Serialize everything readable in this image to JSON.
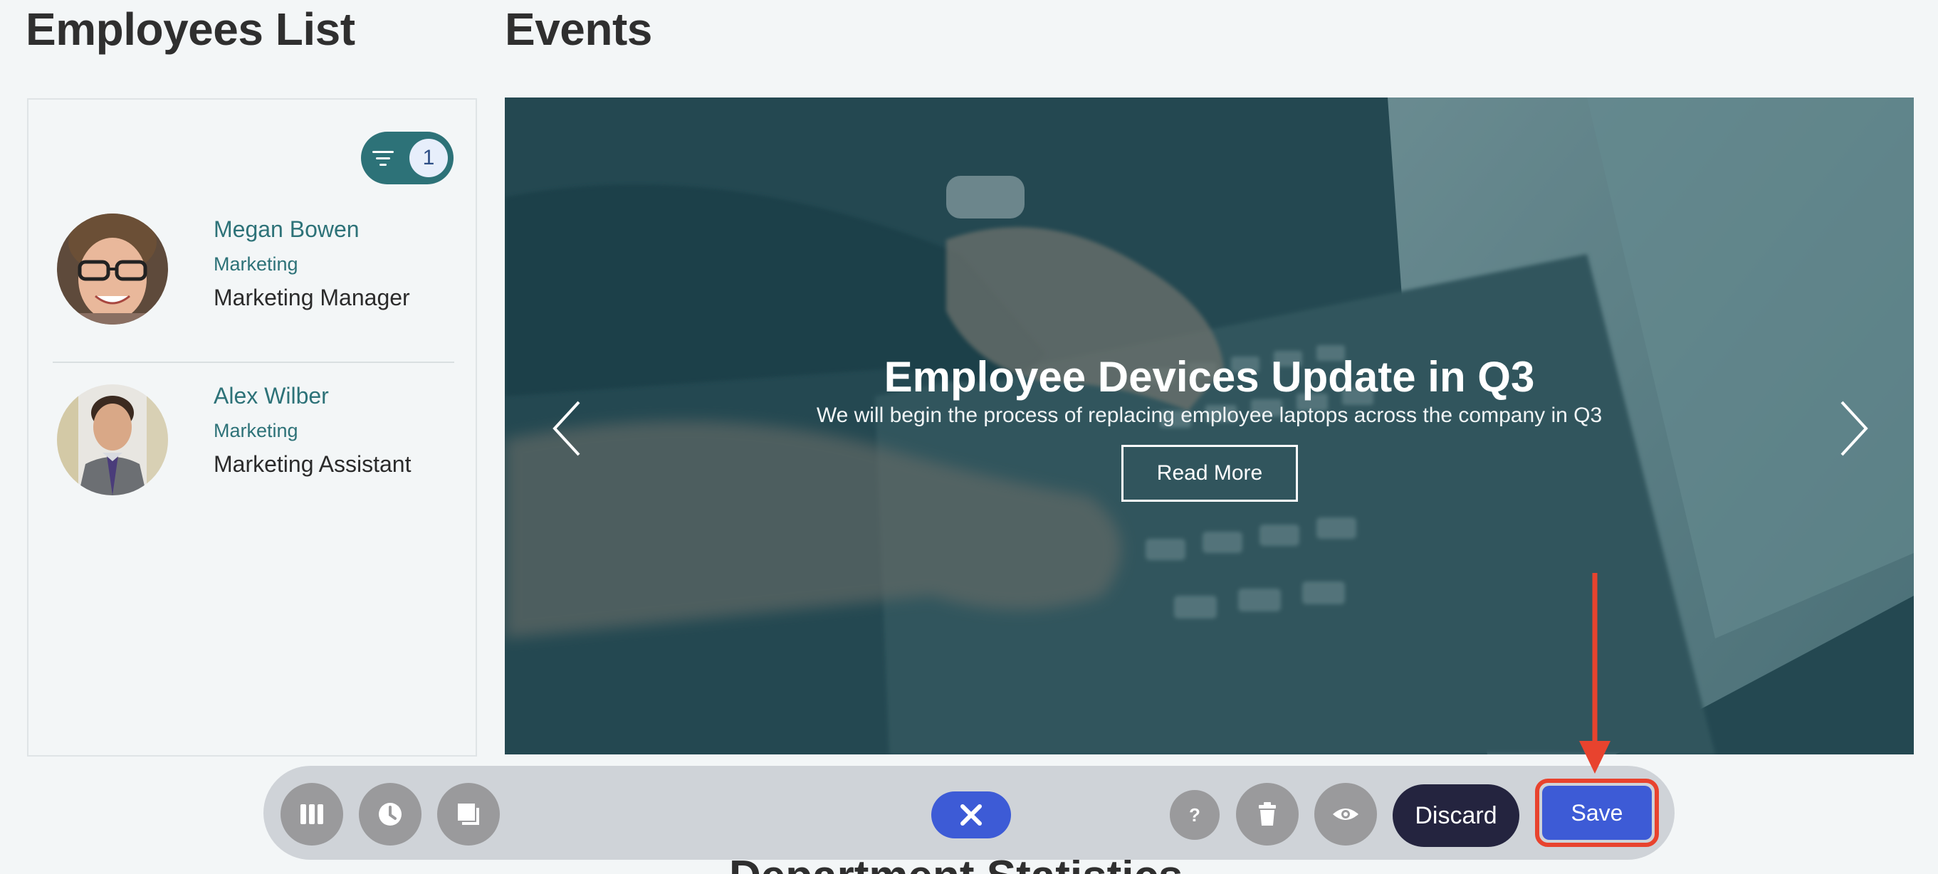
{
  "employees_section": {
    "title": "Employees List",
    "filter_count": "1",
    "employees": [
      {
        "name": "Megan Bowen",
        "department": "Marketing",
        "role": "Marketing Manager"
      },
      {
        "name": "Alex Wilber",
        "department": "Marketing",
        "role": "Marketing Assistant"
      }
    ]
  },
  "events_section": {
    "title": "Events",
    "slide": {
      "title": "Employee Devices Update in Q3",
      "description": "We will begin the process of replacing employee laptops across the company in Q3",
      "button_label": "Read More"
    }
  },
  "toolbar": {
    "icons": [
      "columns-icon",
      "clock-icon",
      "layers-icon",
      "close-icon",
      "help-icon",
      "trash-icon",
      "eye-icon"
    ],
    "discard_label": "Discard",
    "save_label": "Save"
  },
  "next_section_title": "Department Statistics",
  "colors": {
    "accent_teal": "#2d7278",
    "primary_blue": "#3d5bd6",
    "discard_dark": "#24243f",
    "annotation_red": "#e8432e"
  }
}
